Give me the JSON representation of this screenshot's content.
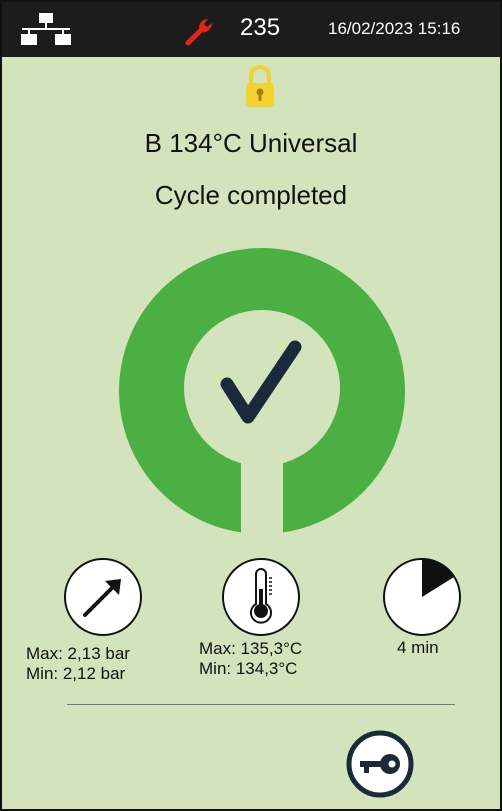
{
  "header": {
    "counter": "235",
    "datetime": "16/02/2023 15:16",
    "icons": [
      "network-icon",
      "wrench-icon"
    ]
  },
  "lock": {
    "icon": "padlock-icon"
  },
  "program": {
    "name": "B 134°C Universal"
  },
  "status": {
    "text": "Cycle completed"
  },
  "result": {
    "icon": "checkmark-icon"
  },
  "readings": {
    "pressure": {
      "icon": "pressure-gauge-icon",
      "max": "Max: 2,13 bar",
      "min": "Min: 2,12 bar"
    },
    "temperature": {
      "icon": "thermometer-icon",
      "max": "Max: 135,3°C",
      "min": "Min: 134,3°C"
    },
    "time": {
      "icon": "timer-icon",
      "value": "4 min"
    }
  },
  "actions": {
    "key_icon": "key-icon"
  },
  "colors": {
    "background": "#d3e4bd",
    "topbar": "#1c1c1c",
    "accent_green": "#4caf44",
    "checkmark": "#1b2a3a",
    "wrench_red": "#e0251b",
    "lock_yellow": "#f2d230"
  }
}
